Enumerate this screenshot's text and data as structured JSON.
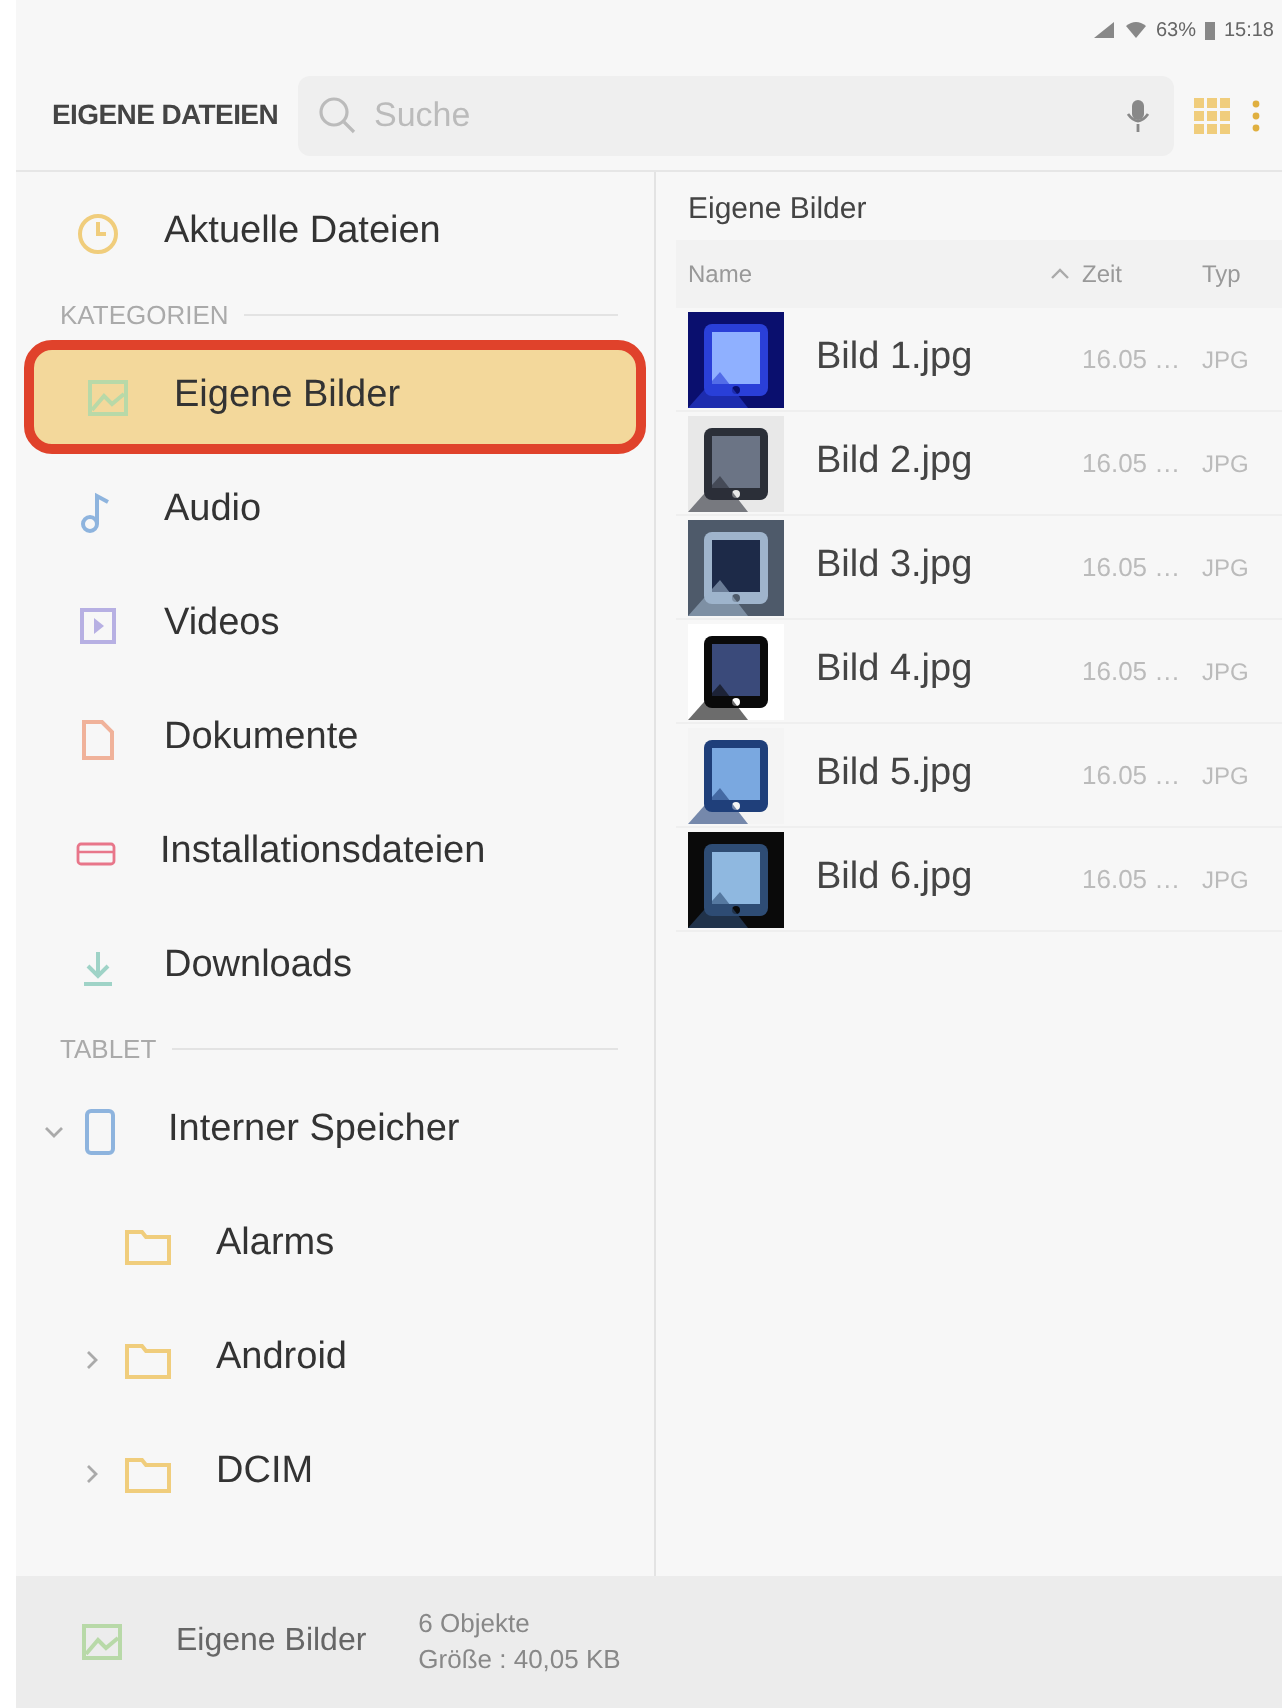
{
  "status_bar": {
    "battery": "63%",
    "time": "15:18"
  },
  "header": {
    "title": "EIGENE DATEIEN",
    "search": {
      "placeholder": "Suche"
    }
  },
  "sidebar": {
    "items": [
      {
        "kind": "item",
        "label": "Aktuelle Dateien",
        "selected": false
      },
      {
        "kind": "section",
        "label": "KATEGORIEN"
      },
      {
        "kind": "item",
        "label": "Eigene Bilder",
        "selected": true
      },
      {
        "kind": "item",
        "label": "Audio",
        "selected": false
      },
      {
        "kind": "item",
        "label": "Videos",
        "selected": false
      },
      {
        "kind": "item",
        "label": "Dokumente",
        "selected": false
      },
      {
        "kind": "item",
        "label": "Installationsdateien",
        "selected": false
      },
      {
        "kind": "item",
        "label": "Downloads",
        "selected": false
      },
      {
        "kind": "section",
        "label": "TABLET"
      },
      {
        "kind": "storage",
        "label": "Interner Speicher",
        "expanded": true,
        "children": [
          {
            "label": "Alarms",
            "has_subfolders": false
          },
          {
            "label": "Android",
            "has_subfolders": true
          },
          {
            "label": "DCIM",
            "has_subfolders": true
          }
        ]
      }
    ]
  },
  "content": {
    "title": "Eigene Bilder",
    "columns": [
      {
        "label": "Name"
      },
      {
        "label": "Zeit"
      },
      {
        "label": "Typ"
      }
    ],
    "files": [
      {
        "name": "Bild 1.jpg",
        "time": "16.05 …",
        "type": "JPG"
      },
      {
        "name": "Bild 2.jpg",
        "time": "16.05 …",
        "type": "JPG"
      },
      {
        "name": "Bild 3.jpg",
        "time": "16.05 …",
        "type": "JPG"
      },
      {
        "name": "Bild 4.jpg",
        "time": "16.05 …",
        "type": "JPG"
      },
      {
        "name": "Bild 5.jpg",
        "time": "16.05 …",
        "type": "JPG"
      },
      {
        "name": "Bild 6.jpg",
        "time": "16.05 …",
        "type": "JPG"
      }
    ]
  },
  "footer": {
    "label": "Eigene Bilder",
    "count": "6 Objekte",
    "size": "Größe : 40,05 KB"
  }
}
